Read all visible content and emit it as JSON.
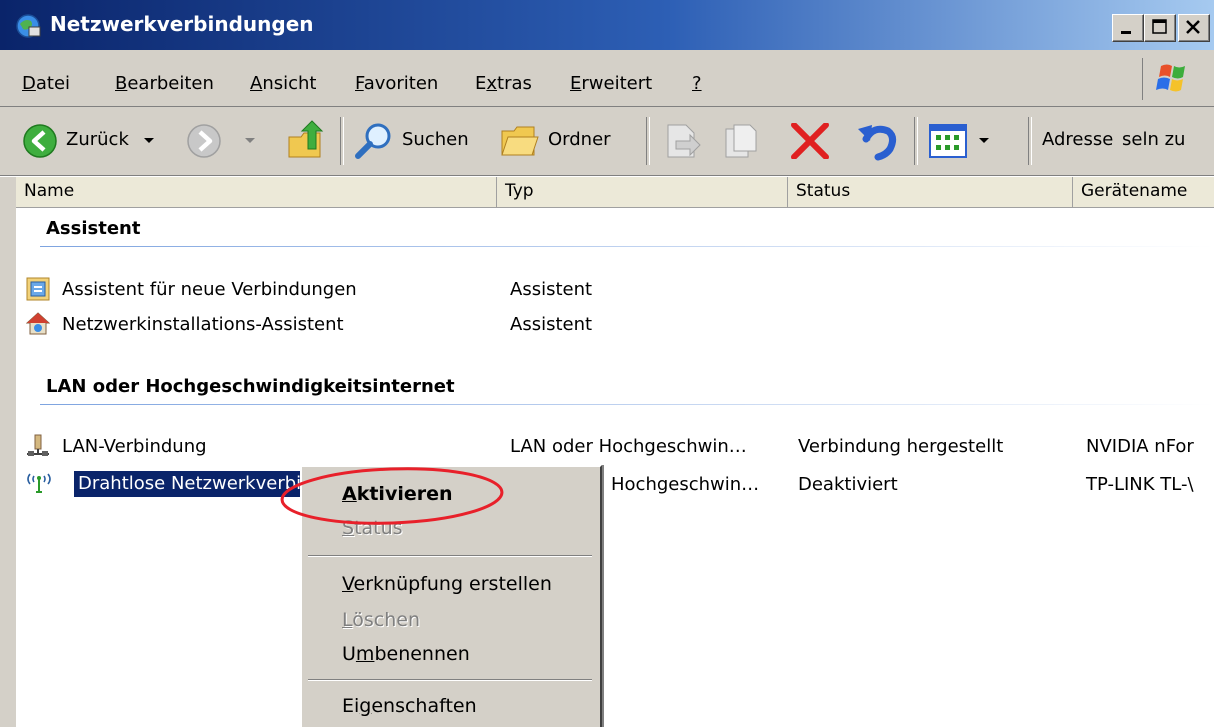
{
  "window": {
    "title": "Netzwerkverbindungen"
  },
  "menubar": {
    "items": [
      {
        "label": "Datei",
        "accel": "D"
      },
      {
        "label": "Bearbeiten",
        "accel": "B"
      },
      {
        "label": "Ansicht",
        "accel": "A"
      },
      {
        "label": "Favoriten",
        "accel": "F"
      },
      {
        "label": "Extras",
        "accel": "x"
      },
      {
        "label": "Erweitert",
        "accel": "E"
      },
      {
        "label": "?",
        "accel": "?"
      }
    ]
  },
  "toolbar": {
    "back_label": "Zurück",
    "search_label": "Suchen",
    "folders_label": "Ordner",
    "address_label": "Adresse",
    "links_label": "seln zu"
  },
  "columns": [
    "Name",
    "Typ",
    "Status",
    "Gerätename"
  ],
  "groups": [
    {
      "title": "Assistent",
      "rows": [
        {
          "name": "Assistent für neue Verbindungen",
          "type": "Assistent",
          "status": "",
          "device": ""
        },
        {
          "name": "Netzwerkinstallations-Assistent",
          "type": "Assistent",
          "status": "",
          "device": ""
        }
      ]
    },
    {
      "title": "LAN oder Hochgeschwindigkeitsinternet",
      "rows": [
        {
          "name": "LAN-Verbindung",
          "type": "LAN oder Hochgeschwin…",
          "status": "Verbindung hergestellt",
          "device": "NVIDIA nFor"
        },
        {
          "name": "Drahtlose Netzwerkverbi",
          "type": "Hochgeschwin…",
          "status": "Deaktiviert",
          "device": "TP-LINK TL-\\"
        }
      ]
    }
  ],
  "context_menu": {
    "items": [
      {
        "label": "Aktivieren",
        "accel": "A",
        "bold": true,
        "disabled": false
      },
      {
        "label": "Status",
        "accel": "S",
        "bold": false,
        "disabled": true
      },
      {
        "label": "Verknüpfung erstellen",
        "accel": "V",
        "bold": false,
        "disabled": false
      },
      {
        "label": "Löschen",
        "accel": "L",
        "bold": false,
        "disabled": true
      },
      {
        "label": "Umbenennen",
        "accel": "m",
        "bold": false,
        "disabled": false
      },
      {
        "label": "Eigenschaften",
        "accel": "g",
        "bold": false,
        "disabled": false
      }
    ]
  },
  "colors": {
    "titlebar": "#0a246a",
    "selection": "#0a246a",
    "highlight_circle": "#e8202a",
    "face": "#d4d0c8"
  }
}
